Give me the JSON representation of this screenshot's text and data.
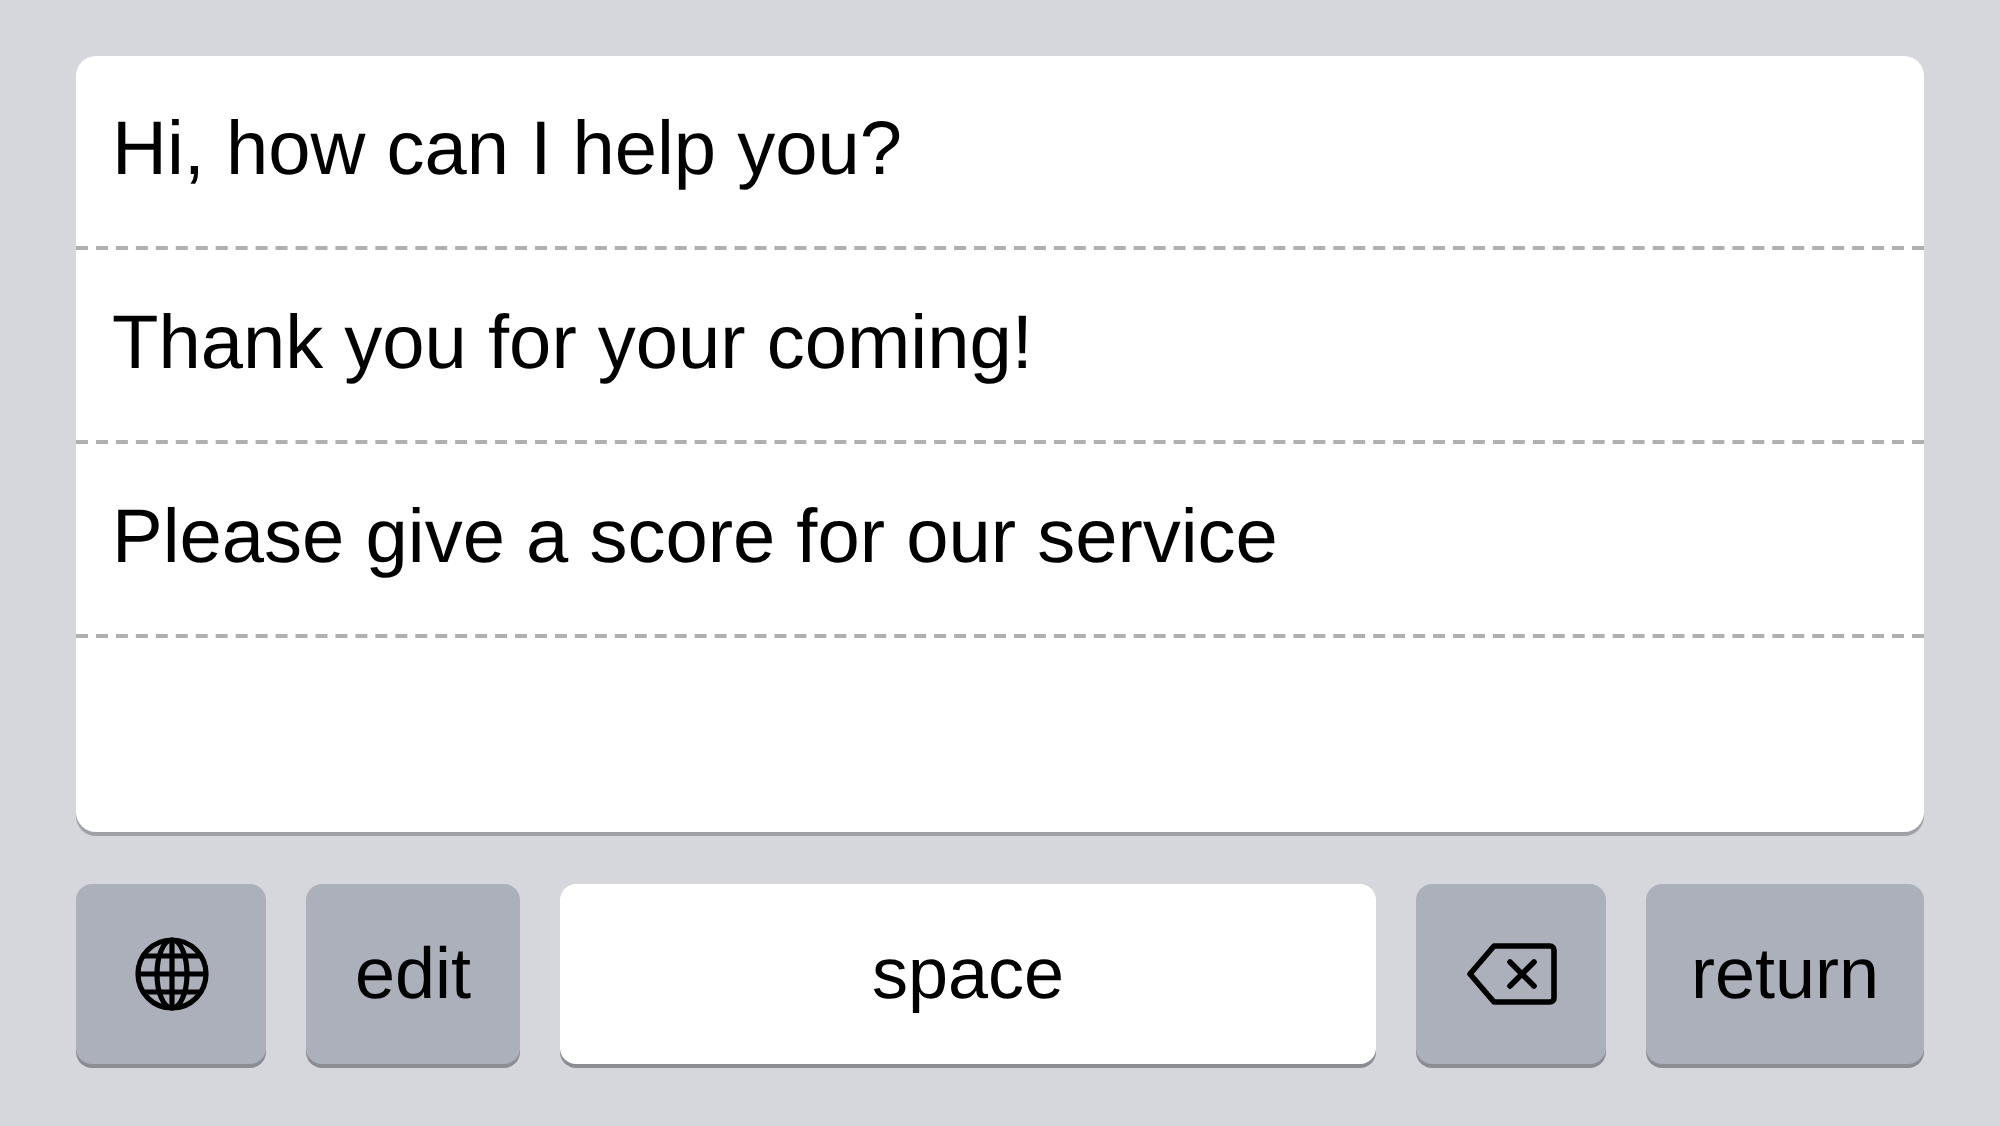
{
  "phrases": [
    {
      "text": "Hi, how can I help you?"
    },
    {
      "text": "Thank you for your coming!"
    },
    {
      "text": "Please give a score for our service"
    }
  ],
  "keys": [
    {
      "kind": "globe"
    },
    {
      "kind": "text",
      "label": "edit"
    },
    {
      "kind": "space",
      "label": "space"
    },
    {
      "kind": "delete"
    },
    {
      "kind": "text",
      "label": "return"
    }
  ]
}
